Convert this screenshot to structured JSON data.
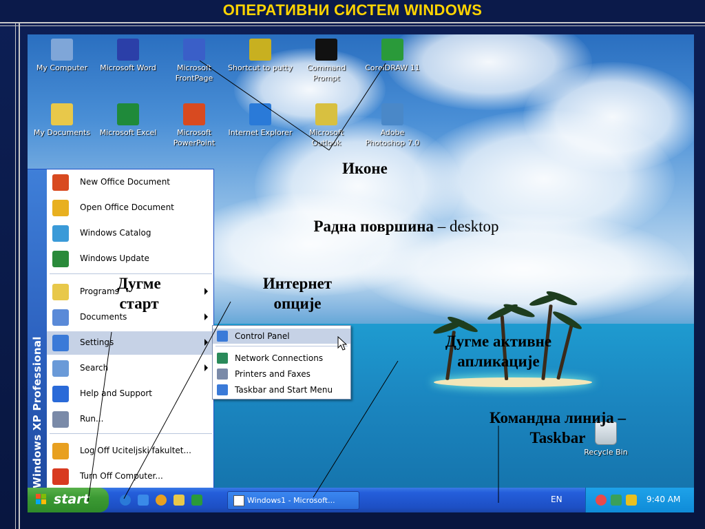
{
  "slide": {
    "title": "ОПЕРАТИВНИ СИСТЕМ WINDOWS"
  },
  "desktop": {
    "icons": [
      {
        "label": "My Computer",
        "icon": "my-computer-icon",
        "color": "#7fa6d8"
      },
      {
        "label": "Microsoft Word",
        "icon": "word-icon",
        "color": "#2b3fa8"
      },
      {
        "label": "Microsoft FrontPage",
        "icon": "frontpage-icon",
        "color": "#3a5fc8"
      },
      {
        "label": "Shortcut to putty",
        "icon": "putty-icon",
        "color": "#c8b020"
      },
      {
        "label": "Command Prompt",
        "icon": "command-prompt-icon",
        "color": "#111111"
      },
      {
        "label": "CorelDRAW 11",
        "icon": "coreldraw-icon",
        "color": "#2a9a3a"
      },
      {
        "label": "My Documents",
        "icon": "my-documents-icon",
        "color": "#e8c84a"
      },
      {
        "label": "Microsoft Excel",
        "icon": "excel-icon",
        "color": "#1f8a3a"
      },
      {
        "label": "Microsoft PowerPoint",
        "icon": "powerpoint-icon",
        "color": "#d84a20"
      },
      {
        "label": "Internet Explorer",
        "icon": "internet-explorer-icon",
        "color": "#2a7ad8"
      },
      {
        "label": "Microsoft Outlook",
        "icon": "outlook-icon",
        "color": "#d8c040"
      },
      {
        "label": "Adobe Photoshop 7.0",
        "icon": "photoshop-icon",
        "color": "#4a88c8"
      }
    ],
    "recycle_bin": "Recycle Bin"
  },
  "start_menu": {
    "side_label": "Windows XP Professional",
    "items": [
      {
        "label": "New Office Document",
        "icon": "new-office-document-icon",
        "color": "#d84a20",
        "arrow": false
      },
      {
        "label": "Open Office Document",
        "icon": "open-office-document-icon",
        "color": "#e8b020",
        "arrow": false
      },
      {
        "label": "Windows Catalog",
        "icon": "windows-catalog-icon",
        "color": "#3a9ad8",
        "arrow": false
      },
      {
        "label": "Windows Update",
        "icon": "windows-update-icon",
        "color": "#2a8a3a",
        "arrow": false
      },
      {
        "label": "Programs",
        "icon": "programs-icon",
        "color": "#e8c84a",
        "arrow": true
      },
      {
        "label": "Documents",
        "icon": "documents-icon",
        "color": "#5a8ad8",
        "arrow": true
      },
      {
        "label": "Settings",
        "icon": "settings-icon",
        "color": "#3a7ad8",
        "arrow": true
      },
      {
        "label": "Search",
        "icon": "search-icon",
        "color": "#6a9ad8",
        "arrow": true
      },
      {
        "label": "Help and Support",
        "icon": "help-icon",
        "color": "#2a6ad8",
        "arrow": false
      },
      {
        "label": "Run...",
        "icon": "run-icon",
        "color": "#7a8aa8",
        "arrow": false
      },
      {
        "label": "Log Off Uciteljski fakultet...",
        "icon": "log-off-icon",
        "color": "#e8a020",
        "arrow": false
      },
      {
        "label": "Turn Off Computer...",
        "icon": "turn-off-icon",
        "color": "#d83a20",
        "arrow": false
      }
    ],
    "settings_submenu": [
      {
        "label": "Control Panel",
        "icon": "control-panel-icon",
        "color": "#3a7ad8"
      },
      {
        "label": "Network Connections",
        "icon": "network-connections-icon",
        "color": "#2a8a5a"
      },
      {
        "label": "Printers and Faxes",
        "icon": "printers-icon",
        "color": "#7a8aa8"
      },
      {
        "label": "Taskbar and Start Menu",
        "icon": "taskbar-settings-icon",
        "color": "#3a7ad8"
      }
    ]
  },
  "taskbar": {
    "start_label": "start",
    "active_app": "Windows1 - Microsoft...",
    "language": "EN",
    "clock": "9:40 AM"
  },
  "annotations": {
    "icons": "Иконе",
    "desktop_prefix": "Радна површина",
    "desktop_suffix": " – desktop",
    "start_button_line1": "Дугме",
    "start_button_line2": "старт",
    "internet_line1": "Интернет",
    "internet_line2": "опције",
    "active_app_line1": "Дугме активне",
    "active_app_line2": "апликације",
    "taskbar_line1": "Командна линија –",
    "taskbar_line2": "Taskbar"
  }
}
